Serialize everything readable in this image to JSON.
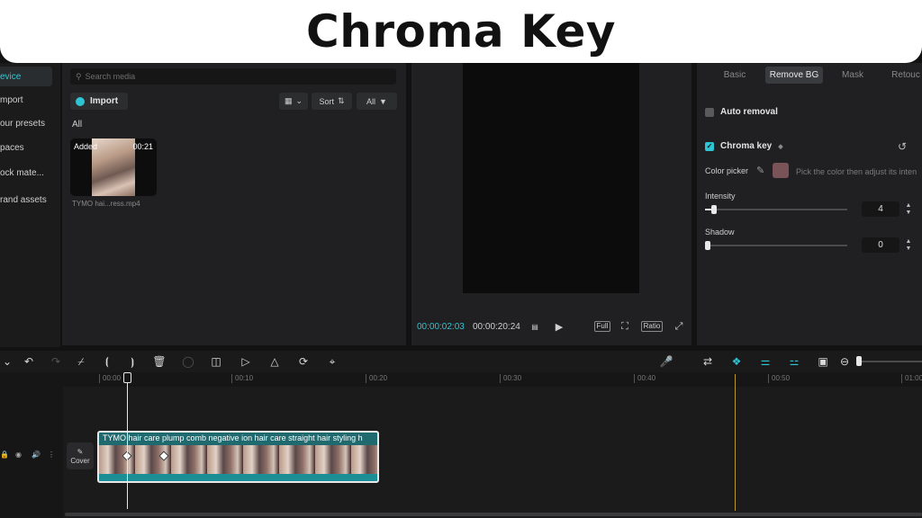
{
  "banner": {
    "title": "Chroma Key"
  },
  "sidenav": {
    "items": [
      {
        "label": "evice",
        "active": true
      },
      {
        "label": "mport",
        "active": false
      },
      {
        "label": "our presets",
        "active": false
      },
      {
        "label": "paces",
        "active": false
      },
      {
        "label": "ock mate...",
        "active": false
      },
      {
        "label": "rand assets",
        "active": false
      }
    ]
  },
  "media": {
    "search_placeholder": "Search media",
    "import_label": "Import",
    "sort_label": "Sort",
    "all_filter_label": "All",
    "section_label": "All",
    "items": [
      {
        "badge": "Added",
        "duration": "00:21",
        "name": "TYMO hai...ress.mp4"
      }
    ]
  },
  "player": {
    "current_time": "00:00:02:03",
    "total_time": "00:00:20:24",
    "full_label": "Full",
    "ratio_label": "Ratio"
  },
  "inspector": {
    "tabs": [
      "Basic",
      "Remove BG",
      "Mask",
      "Retouc"
    ],
    "active_tab": "Remove BG",
    "auto_removal_label": "Auto removal",
    "chroma_key_label": "Chroma key",
    "chroma_key_checked": true,
    "color_picker_label": "Color picker",
    "picked_color": "#7a5358",
    "hint": "Pick the color then adjust its inten",
    "intensity_label": "Intensity",
    "intensity_value": "4",
    "shadow_label": "Shadow",
    "shadow_value": "0"
  },
  "timeline": {
    "ruler_labels": [
      "00:00",
      "00:10",
      "00:20",
      "00:30",
      "00:40",
      "00:50",
      "01:00"
    ],
    "cover_label": "Cover",
    "clip_title": "TYMO hair care plump comb negative ion hair care straight hair styling h"
  },
  "colors": {
    "accent": "#2fc4d4",
    "panel": "#202022",
    "background": "#121212"
  }
}
